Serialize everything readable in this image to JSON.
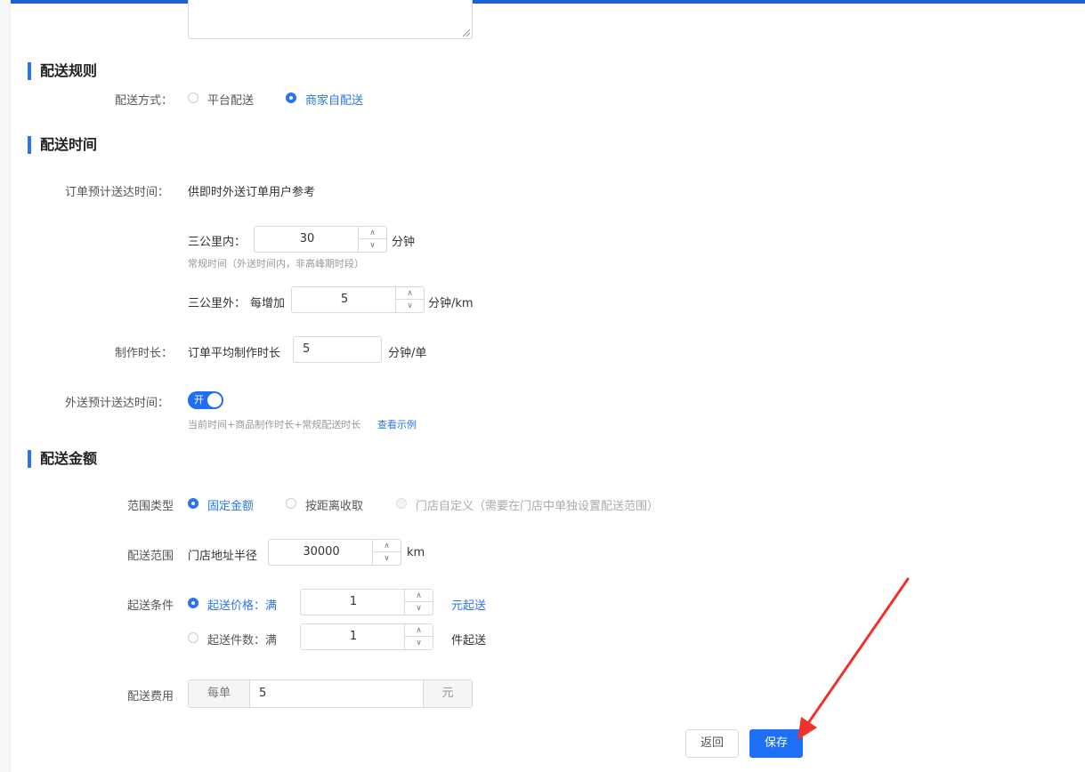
{
  "delivery_rules": {
    "title": "配送规则",
    "method_label": "配送方式：",
    "options": [
      {
        "label": "平台配送",
        "checked": false
      },
      {
        "label": "商家自配送",
        "checked": true
      }
    ]
  },
  "delivery_time": {
    "title": "配送时间",
    "order_eta_label": "订单预计送达时间：",
    "order_eta_desc": "供即时外送订单用户参考",
    "within_3km_label": "三公里内：",
    "within_3km_value": "30",
    "within_3km_unit": "分钟",
    "within_3km_hint": "常规时间（外送时间内，非高峰期时段）",
    "beyond_3km_label": "三公里外：",
    "beyond_3km_prefix": "每增加",
    "beyond_3km_value": "5",
    "beyond_3km_unit": "分钟/km",
    "prep_label": "制作时长：",
    "prep_prefix": "订单平均制作时长",
    "prep_value": "5",
    "prep_unit": "分钟/单",
    "delivery_eta_label": "外送预计送达时间：",
    "toggle_text": "开",
    "toggle_on": true,
    "delivery_eta_hint": "当前时间+商品制作时长+常规配送时长",
    "example_link": "查看示例"
  },
  "delivery_fee": {
    "title": "配送金额",
    "range_type_label": "范围类型",
    "range_type_options": [
      {
        "label": "固定金额",
        "checked": true
      },
      {
        "label": "按距离收取",
        "checked": false
      },
      {
        "label": "门店自定义（需要在门店中单独设置配送范围）",
        "checked": false,
        "disabled": true
      }
    ],
    "range_label": "配送范围",
    "range_prefix": "门店地址半径",
    "range_value": "30000",
    "range_unit": "km",
    "min_label": "起送条件",
    "min_price_option": "起送价格：满",
    "min_price_value": "1",
    "min_price_unit": "元起送",
    "min_count_option": "起送件数：满",
    "min_count_value": "1",
    "min_count_unit": "件起送",
    "fee_label": "配送费用",
    "fee_prefix": "每单",
    "fee_value": "5",
    "fee_suffix": "元"
  },
  "actions": {
    "back_label": "返回",
    "save_label": "保存"
  },
  "colors": {
    "accent": "#2a74f0",
    "top_bar": "#1e5fd4",
    "annotation_arrow": "#f0322d"
  }
}
